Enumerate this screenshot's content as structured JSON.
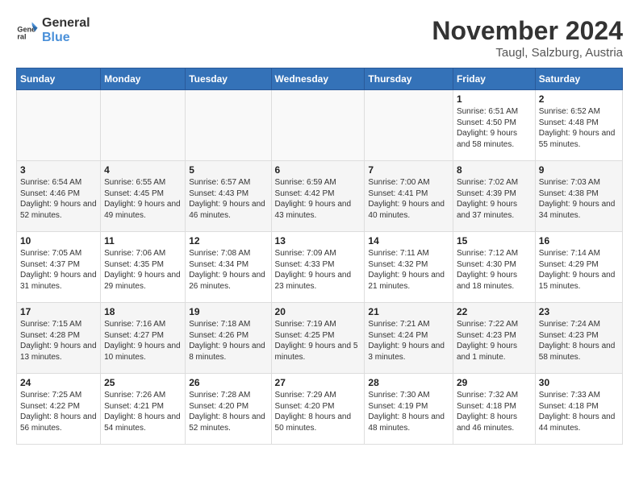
{
  "logo": {
    "line1": "General",
    "line2": "Blue"
  },
  "header": {
    "month_year": "November 2024",
    "location": "Taugl, Salzburg, Austria"
  },
  "weekdays": [
    "Sunday",
    "Monday",
    "Tuesday",
    "Wednesday",
    "Thursday",
    "Friday",
    "Saturday"
  ],
  "weeks": [
    [
      {
        "day": "",
        "info": ""
      },
      {
        "day": "",
        "info": ""
      },
      {
        "day": "",
        "info": ""
      },
      {
        "day": "",
        "info": ""
      },
      {
        "day": "",
        "info": ""
      },
      {
        "day": "1",
        "info": "Sunrise: 6:51 AM\nSunset: 4:50 PM\nDaylight: 9 hours and 58 minutes."
      },
      {
        "day": "2",
        "info": "Sunrise: 6:52 AM\nSunset: 4:48 PM\nDaylight: 9 hours and 55 minutes."
      }
    ],
    [
      {
        "day": "3",
        "info": "Sunrise: 6:54 AM\nSunset: 4:46 PM\nDaylight: 9 hours and 52 minutes."
      },
      {
        "day": "4",
        "info": "Sunrise: 6:55 AM\nSunset: 4:45 PM\nDaylight: 9 hours and 49 minutes."
      },
      {
        "day": "5",
        "info": "Sunrise: 6:57 AM\nSunset: 4:43 PM\nDaylight: 9 hours and 46 minutes."
      },
      {
        "day": "6",
        "info": "Sunrise: 6:59 AM\nSunset: 4:42 PM\nDaylight: 9 hours and 43 minutes."
      },
      {
        "day": "7",
        "info": "Sunrise: 7:00 AM\nSunset: 4:41 PM\nDaylight: 9 hours and 40 minutes."
      },
      {
        "day": "8",
        "info": "Sunrise: 7:02 AM\nSunset: 4:39 PM\nDaylight: 9 hours and 37 minutes."
      },
      {
        "day": "9",
        "info": "Sunrise: 7:03 AM\nSunset: 4:38 PM\nDaylight: 9 hours and 34 minutes."
      }
    ],
    [
      {
        "day": "10",
        "info": "Sunrise: 7:05 AM\nSunset: 4:37 PM\nDaylight: 9 hours and 31 minutes."
      },
      {
        "day": "11",
        "info": "Sunrise: 7:06 AM\nSunset: 4:35 PM\nDaylight: 9 hours and 29 minutes."
      },
      {
        "day": "12",
        "info": "Sunrise: 7:08 AM\nSunset: 4:34 PM\nDaylight: 9 hours and 26 minutes."
      },
      {
        "day": "13",
        "info": "Sunrise: 7:09 AM\nSunset: 4:33 PM\nDaylight: 9 hours and 23 minutes."
      },
      {
        "day": "14",
        "info": "Sunrise: 7:11 AM\nSunset: 4:32 PM\nDaylight: 9 hours and 21 minutes."
      },
      {
        "day": "15",
        "info": "Sunrise: 7:12 AM\nSunset: 4:30 PM\nDaylight: 9 hours and 18 minutes."
      },
      {
        "day": "16",
        "info": "Sunrise: 7:14 AM\nSunset: 4:29 PM\nDaylight: 9 hours and 15 minutes."
      }
    ],
    [
      {
        "day": "17",
        "info": "Sunrise: 7:15 AM\nSunset: 4:28 PM\nDaylight: 9 hours and 13 minutes."
      },
      {
        "day": "18",
        "info": "Sunrise: 7:16 AM\nSunset: 4:27 PM\nDaylight: 9 hours and 10 minutes."
      },
      {
        "day": "19",
        "info": "Sunrise: 7:18 AM\nSunset: 4:26 PM\nDaylight: 9 hours and 8 minutes."
      },
      {
        "day": "20",
        "info": "Sunrise: 7:19 AM\nSunset: 4:25 PM\nDaylight: 9 hours and 5 minutes."
      },
      {
        "day": "21",
        "info": "Sunrise: 7:21 AM\nSunset: 4:24 PM\nDaylight: 9 hours and 3 minutes."
      },
      {
        "day": "22",
        "info": "Sunrise: 7:22 AM\nSunset: 4:23 PM\nDaylight: 9 hours and 1 minute."
      },
      {
        "day": "23",
        "info": "Sunrise: 7:24 AM\nSunset: 4:23 PM\nDaylight: 8 hours and 58 minutes."
      }
    ],
    [
      {
        "day": "24",
        "info": "Sunrise: 7:25 AM\nSunset: 4:22 PM\nDaylight: 8 hours and 56 minutes."
      },
      {
        "day": "25",
        "info": "Sunrise: 7:26 AM\nSunset: 4:21 PM\nDaylight: 8 hours and 54 minutes."
      },
      {
        "day": "26",
        "info": "Sunrise: 7:28 AM\nSunset: 4:20 PM\nDaylight: 8 hours and 52 minutes."
      },
      {
        "day": "27",
        "info": "Sunrise: 7:29 AM\nSunset: 4:20 PM\nDaylight: 8 hours and 50 minutes."
      },
      {
        "day": "28",
        "info": "Sunrise: 7:30 AM\nSunset: 4:19 PM\nDaylight: 8 hours and 48 minutes."
      },
      {
        "day": "29",
        "info": "Sunrise: 7:32 AM\nSunset: 4:18 PM\nDaylight: 8 hours and 46 minutes."
      },
      {
        "day": "30",
        "info": "Sunrise: 7:33 AM\nSunset: 4:18 PM\nDaylight: 8 hours and 44 minutes."
      }
    ]
  ]
}
